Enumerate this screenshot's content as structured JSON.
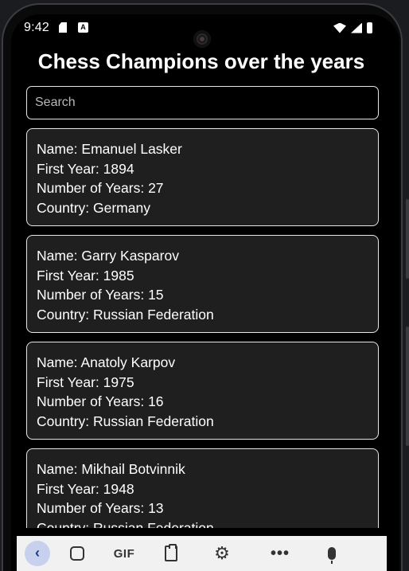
{
  "status_bar": {
    "time": "9:42",
    "left_icons": [
      "sd-card-icon",
      "keyboard-a-icon"
    ],
    "right_icons": [
      "wifi-icon",
      "cell-signal-icon",
      "battery-icon"
    ]
  },
  "header": {
    "title": "Chess Champions over the years"
  },
  "search": {
    "placeholder": "Search",
    "value": ""
  },
  "champions": [
    {
      "name": "Name: Emanuel Lasker",
      "first_year": "First Year: 1894",
      "num_years": "Number of Years: 27",
      "country": "Country: Germany"
    },
    {
      "name": "Name: Garry Kasparov",
      "first_year": "First Year: 1985",
      "num_years": "Number of Years: 15",
      "country": "Country: Russian Federation"
    },
    {
      "name": "Name: Anatoly Karpov",
      "first_year": "First Year: 1975",
      "num_years": "Number of Years: 16",
      "country": "Country: Russian Federation"
    },
    {
      "name": "Name: Mikhail Botvinnik",
      "first_year": "First Year: 1948",
      "num_years": "Number of Years: 13",
      "country": "Country: Russian Federation"
    }
  ],
  "keyboard_toolbar": {
    "back_glyph": "‹",
    "gif_label": "GIF",
    "more_glyph": "•••",
    "settings_glyph": "⚙",
    "icons": [
      "back-chevron-icon",
      "sticker-icon",
      "gif-icon",
      "clipboard-icon",
      "gear-icon",
      "more-icon",
      "microphone-icon"
    ]
  }
}
